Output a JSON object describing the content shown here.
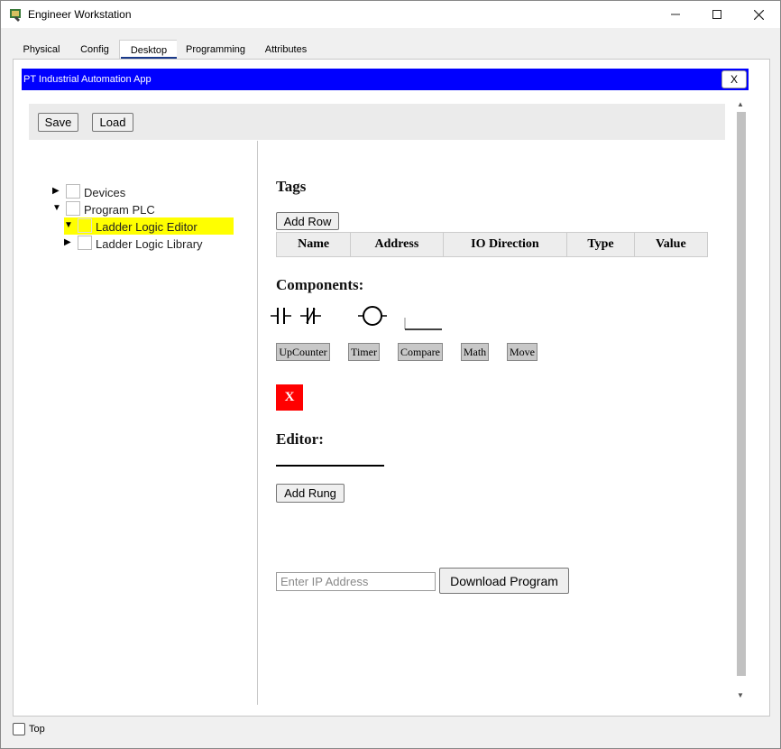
{
  "window": {
    "title": "Engineer Workstation"
  },
  "tabs": [
    {
      "label": "Physical"
    },
    {
      "label": "Config"
    },
    {
      "label": "Desktop"
    },
    {
      "label": "Programming"
    },
    {
      "label": "Attributes"
    }
  ],
  "app": {
    "title": "PT Industrial Automation App",
    "close_label": "X"
  },
  "toolbar": {
    "save_label": "Save",
    "load_label": "Load"
  },
  "tree": {
    "devices": "Devices",
    "program_plc": "Program PLC",
    "ladder_editor": "Ladder Logic Editor",
    "ladder_library": "Ladder Logic Library"
  },
  "tags": {
    "heading": "Tags",
    "add_row_label": "Add Row",
    "columns": [
      "Name",
      "Address",
      "IO Direction",
      "Type",
      "Value"
    ]
  },
  "components": {
    "heading": "Components:",
    "buttons": [
      "UpCounter",
      "Timer",
      "Compare",
      "Math",
      "Move"
    ],
    "delete_label": "X"
  },
  "editor": {
    "heading": "Editor:",
    "add_rung_label": "Add Rung"
  },
  "download": {
    "ip_placeholder": "Enter IP Address",
    "button_label": "Download Program"
  },
  "footer": {
    "top_label": "Top"
  },
  "colors": {
    "app_bar": "#0000ff",
    "highlight": "#ffff00",
    "delete": "#ff0000"
  }
}
